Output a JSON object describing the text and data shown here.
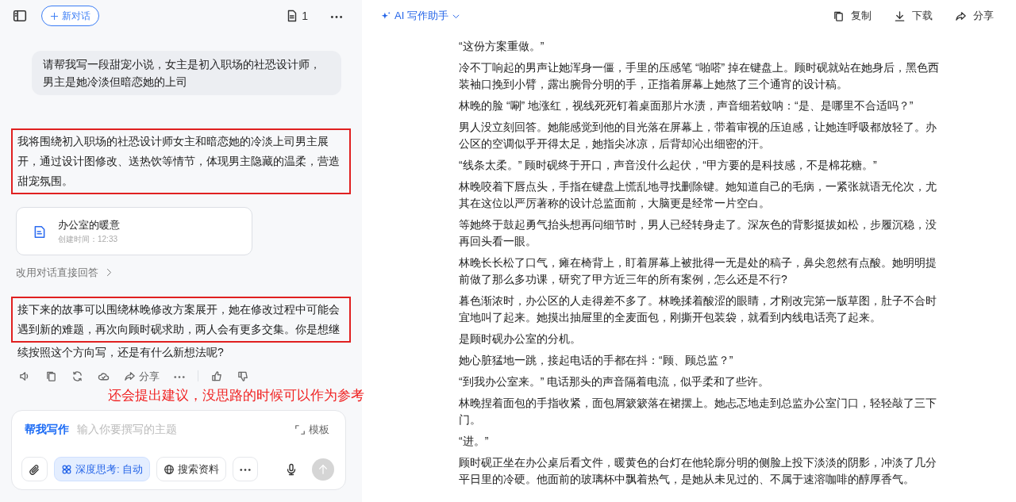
{
  "left_panel": {
    "new_chat_button": "新对话",
    "doc_count": "1",
    "user_message": "请帮我写一段甜宠小说，女主是初入职场的社恐设计师，男主是她冷淡但暗恋她的上司",
    "ai_messages": [
      {
        "kind": "plan",
        "text": "我将围绕初入职场的社恐设计师女主和暗恋她的冷淡上司男主展开，通过设计图修改、送热饮等情节，体现男主隐藏的温柔，营造甜宠氛围。",
        "highlighted": true
      },
      {
        "kind": "document",
        "title": "办公室的暖意",
        "created": "创建时间：12:33"
      },
      {
        "kind": "link",
        "text": "改用对话直接回答"
      },
      {
        "kind": "reply",
        "highlighted_text": "接下来的故事可以围绕林晚修改方案展开，她在修改过程中可能会遇到新的难题，再次向顾时砚求助，两人会有更多交集。你是想继",
        "text": "续按照这个方向写，还是有什么新想法呢?"
      }
    ],
    "share_label": "分享",
    "annotation": "还会提出建议，没思路的时候可以作为参考",
    "composer": {
      "mode": "帮我写作",
      "placeholder": "输入你要撰写的主题",
      "template": "模板",
      "deep_think": {
        "label": "深度思考: 自动",
        "selected": true
      },
      "search": {
        "label": "搜索资料",
        "selected": false
      }
    }
  },
  "document_panel": {
    "title": "AI 写作助手",
    "actions": [
      "复制",
      "下载",
      "分享"
    ],
    "paragraphs": [
      "“这份方案重做。”",
      "冷不丁响起的男声让她浑身一僵，手里的压感笔 “啪嗒” 掉在键盘上。顾时砚就站在她身后，黑色西装袖口挽到小臂，露出腕骨分明的手，正指着屏幕上她熬了三个通宵的设计稿。",
      "林晚的脸 “唰” 地涨红，视线死死钉着桌面那片水渍，声音细若蚊呐：“是、是哪里不合适吗？”",
      "男人没立刻回答。她能感觉到他的目光落在屏幕上，带着审视的压迫感，让她连呼吸都放轻了。办公区的空调似乎开得太足，她指尖冰凉，后背却沁出细密的汗。",
      "“线条太柔。” 顾时砚终于开口，声音没什么起伏，“甲方要的是科技感，不是棉花糖。”",
      "林晚咬着下唇点头，手指在键盘上慌乱地寻找删除键。她知道自己的毛病，一紧张就语无伦次，尤其在这位以严厉著称的设计总监面前，大脑更是经常一片空白。",
      "等她终于鼓起勇气抬头想再问细节时，男人已经转身走了。深灰色的背影挺拔如松，步履沉稳，没再回头看一眼。",
      "林晚长长松了口气，瘫在椅背上，盯着屏幕上被批得一无是处的稿子，鼻尖忽然有点酸。她明明提前做了那么多功课，研究了甲方近三年的所有案例，怎么还是不行?",
      "暮色渐浓时，办公区的人走得差不多了。林晚揉着酸涩的眼睛，才刚改完第一版草图，肚子不合时宜地叫了起来。她摸出抽屉里的全麦面包，刚撕开包装袋，就看到内线电话亮了起来。",
      "是顾时砚办公室的分机。",
      "她心脏猛地一跳，接起电话的手都在抖：“顾、顾总监？”",
      "“到我办公室来。” 电话那头的声音隔着电流，似乎柔和了些许。",
      "林晚捏着面包的手指收紧，面包屑簌簌落在裙摆上。她忐忑地走到总监办公室门口，轻轻敲了三下门。",
      "“进。”",
      "顾时砚正坐在办公桌后看文件，暖黄色的台灯在他轮廓分明的侧脸上投下淡淡的阴影，冲淡了几分平日里的冷硬。他面前的玻璃杯中飘着热气，是她从未见过的、不属于速溶咖啡的醇厚香气。"
    ]
  }
}
